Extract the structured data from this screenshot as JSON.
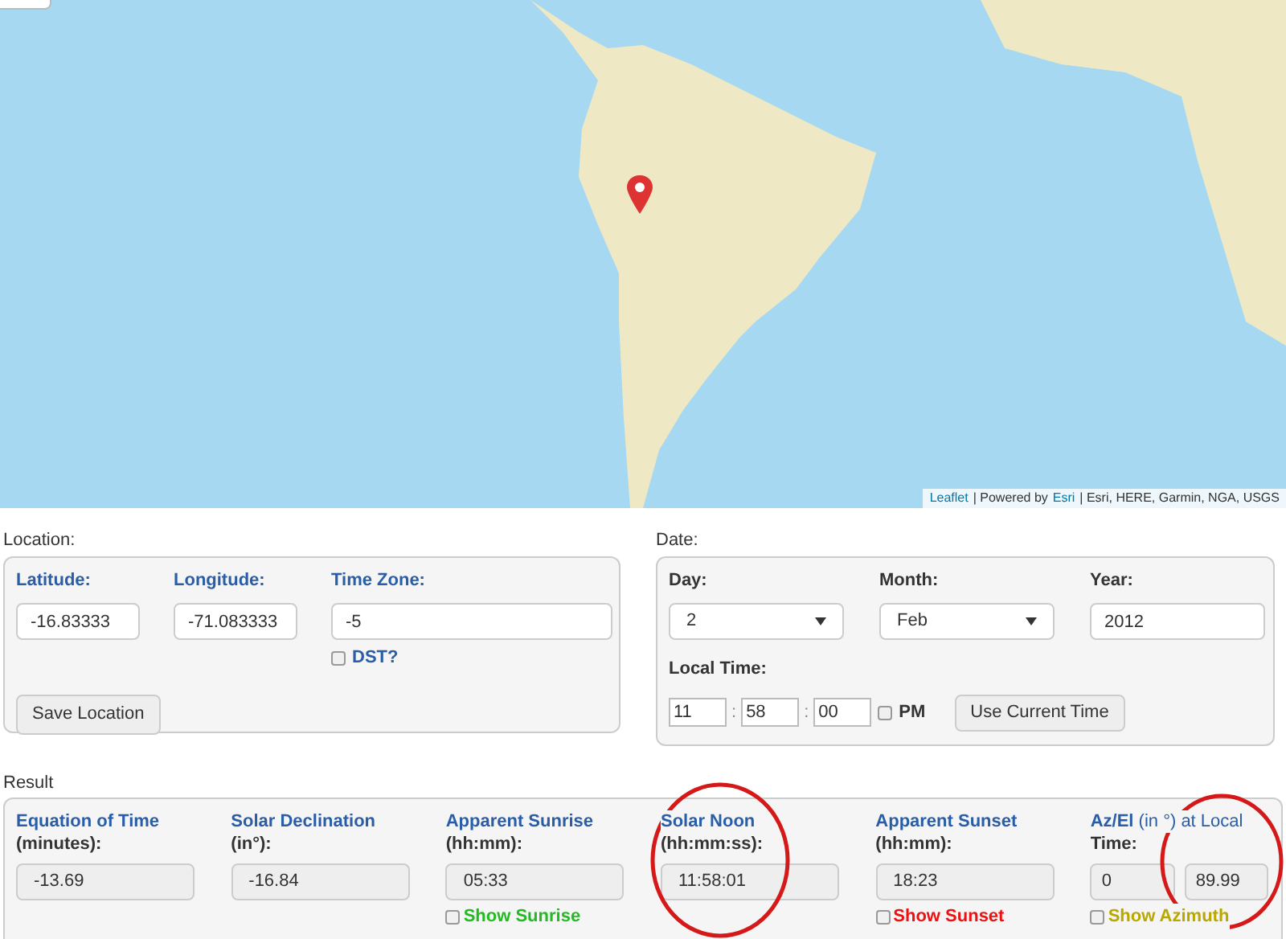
{
  "map": {
    "attribution": [
      {
        "kind": "link",
        "text": "Leaflet"
      },
      {
        "kind": "text",
        "text": "| Powered by"
      },
      {
        "kind": "link",
        "text": "Esri"
      },
      {
        "kind": "text",
        "text": "| Esri, HERE, Garmin, NGA, USGS"
      }
    ]
  },
  "location": {
    "label": "Location:",
    "fields": [
      {
        "label": "Latitude:",
        "value": "-16.83333"
      },
      {
        "label": "Longitude:",
        "value": "-71.083333"
      },
      {
        "label": "Time Zone:",
        "value": "-5"
      }
    ],
    "dst": {
      "label": "DST?",
      "checked": false
    },
    "button": "Save Location"
  },
  "date": {
    "label": "Date:",
    "day": {
      "label": "Day:",
      "value": "2"
    },
    "month": {
      "label": "Month:",
      "value": "Feb"
    },
    "year": {
      "label": "Year:",
      "value": "2012"
    },
    "local_time": {
      "label": "Local Time:",
      "hours": "11",
      "minutes": "58",
      "seconds": "00",
      "separators": [
        ":",
        ":"
      ],
      "pm": {
        "label": "PM",
        "checked": false
      }
    },
    "button": "Use Current Time"
  },
  "result": {
    "label": "Result",
    "columns": [
      {
        "title": "Equation of Time",
        "unit": "(minutes):",
        "values": [
          "-13.69"
        ]
      },
      {
        "title": "Solar Declination",
        "unit": "(in°):",
        "values": [
          "-16.84"
        ]
      },
      {
        "title": "Apparent Sunrise",
        "unit": "(hh:mm):",
        "values": [
          "05:33"
        ],
        "toggle": {
          "label": "Show Sunrise",
          "checked": false,
          "color": "#22bb22"
        }
      },
      {
        "title": "Solar Noon",
        "unit": "(hh:mm:ss):",
        "values": [
          "11:58:01"
        ]
      },
      {
        "title": "Apparent Sunset",
        "unit": "(hh:mm):",
        "values": [
          "18:23"
        ],
        "toggle": {
          "label": "Show Sunset",
          "checked": false,
          "color": "#ee1111"
        }
      },
      {
        "title": "**Az/El** (in °) at Local",
        "unit": "Time:",
        "values": [
          "0",
          "89.99"
        ],
        "toggle": {
          "label": "Show Azimuth",
          "checked": false,
          "color": "#b8a800"
        }
      }
    ]
  }
}
